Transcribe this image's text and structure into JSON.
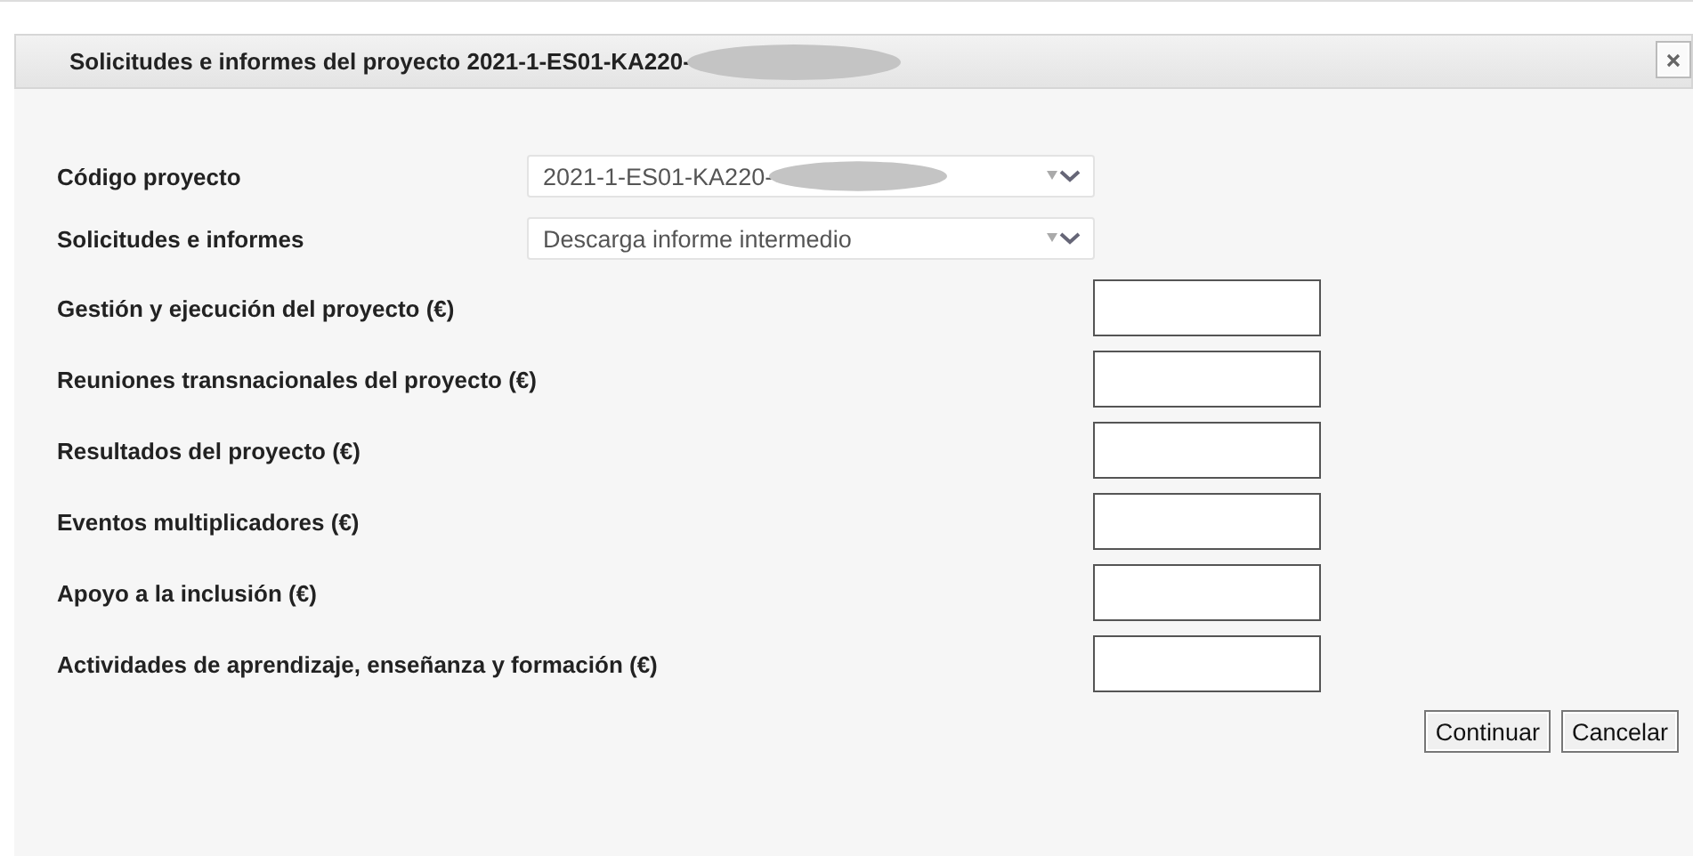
{
  "dialog": {
    "title": "Solicitudes e informes del proyecto 2021-1-ES01-KA220-",
    "title_redacted": true
  },
  "selects": [
    {
      "label": "Código proyecto",
      "value": "2021-1-ES01-KA220-",
      "redacted": true
    },
    {
      "label": "Solicitudes e informes",
      "value": "Descarga informe intermedio",
      "redacted": false
    }
  ],
  "fields": [
    {
      "label": "Gestión y ejecución del proyecto (€)"
    },
    {
      "label": "Reuniones transnacionales del proyecto (€)"
    },
    {
      "label": "Resultados del proyecto (€)"
    },
    {
      "label": "Eventos multiplicadores (€)"
    },
    {
      "label": "Apoyo a la inclusión (€)"
    },
    {
      "label": "Actividades de aprendizaje, enseñanza y formación (€)"
    }
  ],
  "buttons": [
    "Continuar",
    "Cancelar"
  ]
}
